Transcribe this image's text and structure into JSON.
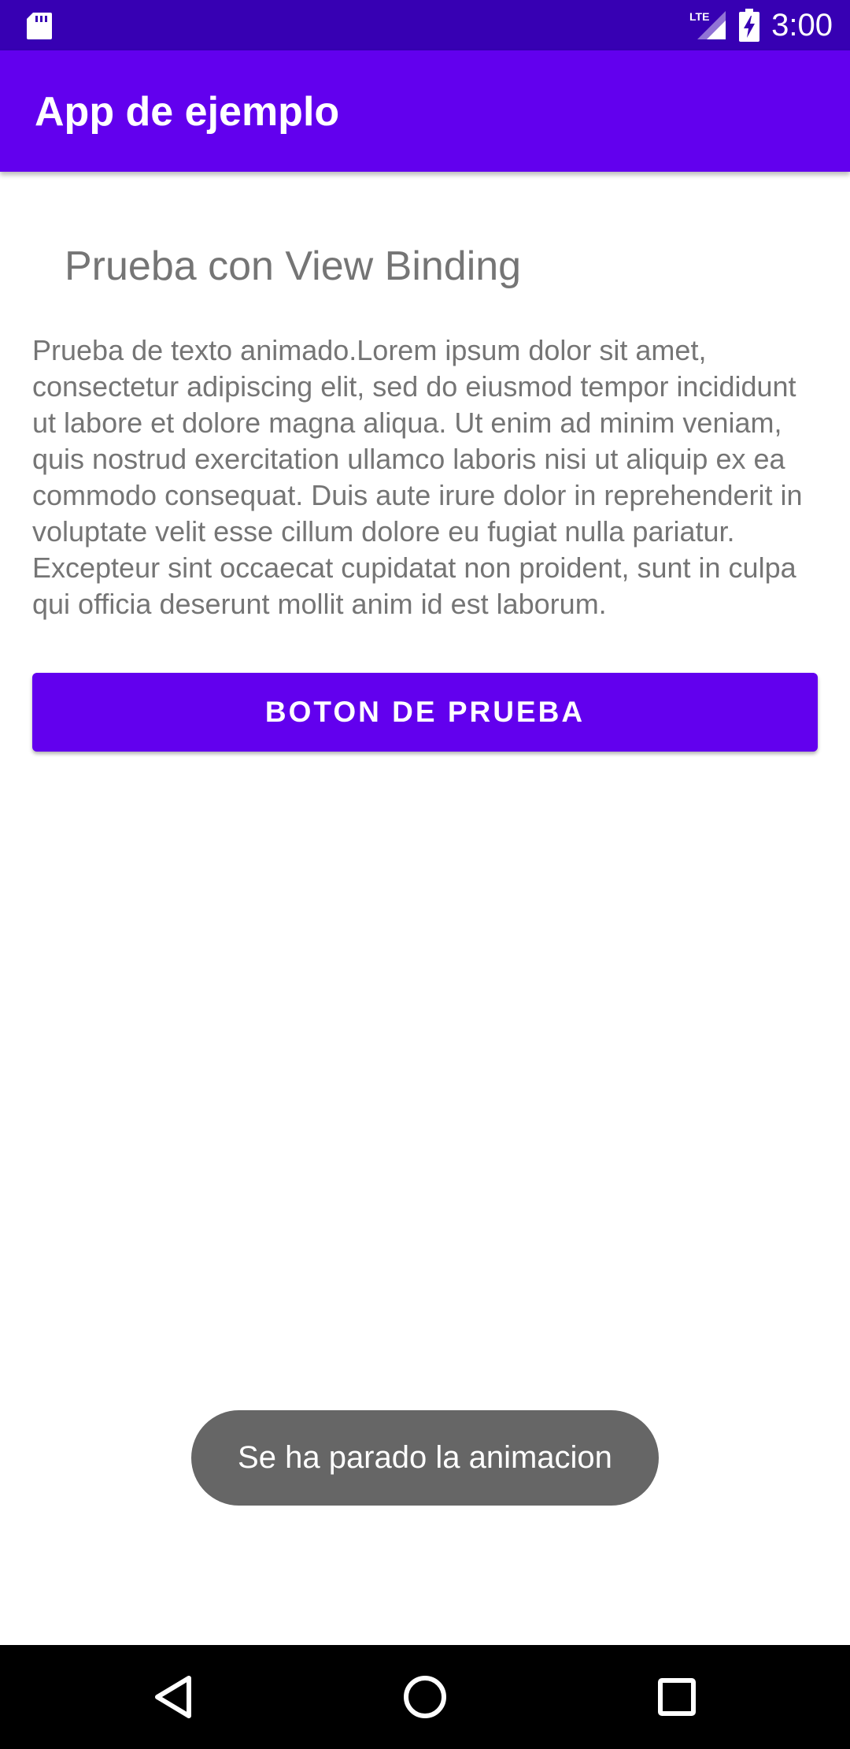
{
  "status_bar": {
    "time": "3:00",
    "network_label": "LTE",
    "icons": [
      "sd-card-icon",
      "lte-signal-icon",
      "battery-charging-icon"
    ],
    "color": "#3700b3"
  },
  "app_bar": {
    "title": "App de ejemplo",
    "color": "#6200ee"
  },
  "main": {
    "heading": "Prueba con View Binding",
    "body_text": "Prueba de texto animado.Lorem ipsum dolor sit amet, consectetur adipiscing elit, sed do eiusmod tempor incididunt ut labore et dolore magna aliqua. Ut enim ad minim veniam, quis nostrud exercitation ullamco laboris nisi ut aliquip ex ea commodo consequat. Duis aute irure dolor in reprehenderit in voluptate velit esse cillum dolore eu fugiat nulla pariatur. Excepteur sint occaecat cupidatat non proident, sunt in culpa qui officia deserunt mollit anim id est laborum.",
    "button_label": "BOTON DE PRUEBA",
    "button_color": "#6200ee"
  },
  "toast": {
    "message": "Se ha parado la animacion"
  },
  "nav_bar": {
    "buttons": [
      "back-icon",
      "home-icon",
      "recents-icon"
    ]
  }
}
